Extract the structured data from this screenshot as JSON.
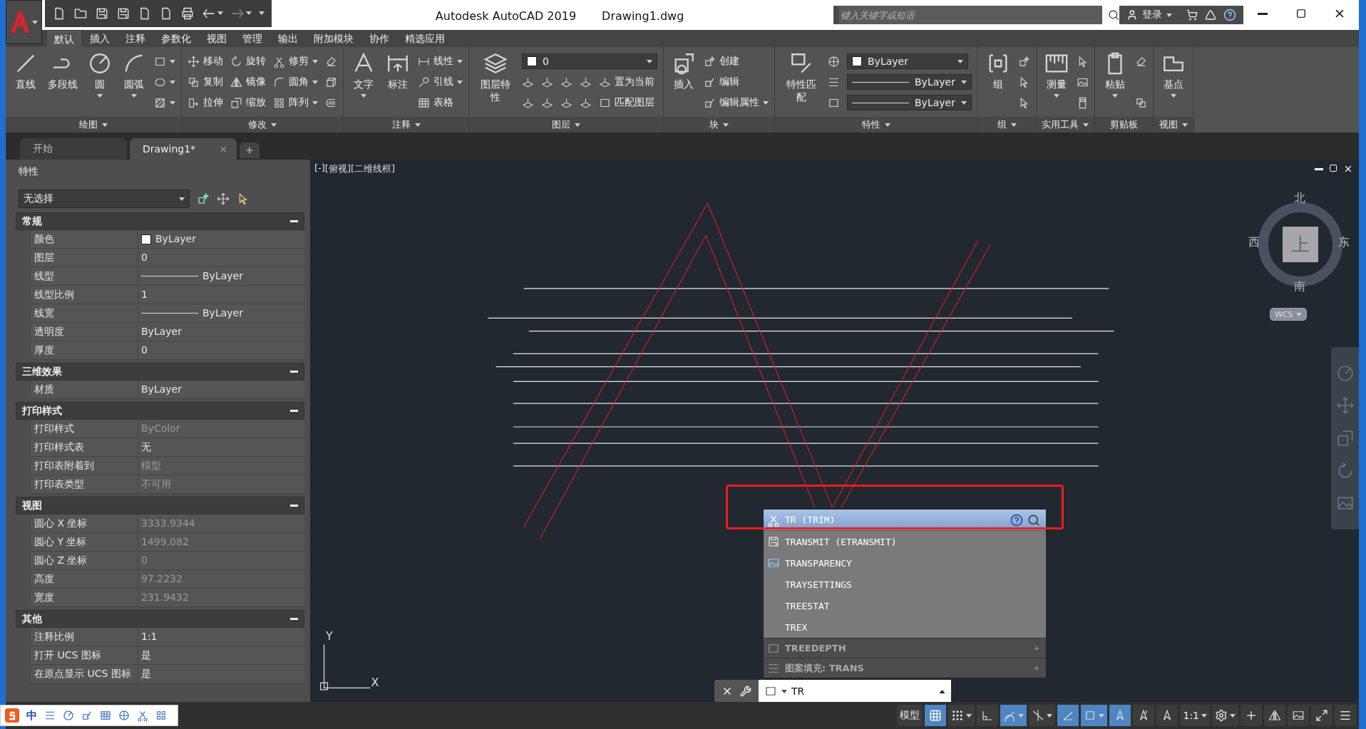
{
  "title_bar": {
    "app": "Autodesk AutoCAD 2019",
    "file": "Drawing1.dwg",
    "search": {
      "placeholder": "键入关键字或短语"
    },
    "login": "登录"
  },
  "ribbon": {
    "tabs": [
      {
        "label": "默认",
        "selected": true
      },
      {
        "label": "插入",
        "selected": false
      },
      {
        "label": "注释",
        "selected": false
      },
      {
        "label": "参数化",
        "selected": false
      },
      {
        "label": "视图",
        "selected": false
      },
      {
        "label": "管理",
        "selected": false
      },
      {
        "label": "输出",
        "selected": false
      },
      {
        "label": "附加模块",
        "selected": false
      },
      {
        "label": "协作",
        "selected": false
      },
      {
        "label": "精选应用",
        "selected": false
      }
    ],
    "panels": [
      {
        "title": "绘图",
        "menu": true,
        "large": [
          {
            "label": "直线",
            "dropdown": false
          },
          {
            "label": "多段线",
            "dropdown": false
          },
          {
            "label": "圆",
            "dropdown": true
          },
          {
            "label": "圆弧",
            "dropdown": true
          }
        ],
        "rows": [
          [
            {
              "kind": "icon",
              "dropdown": true
            }
          ],
          [
            {
              "kind": "icon",
              "dropdown": true
            }
          ],
          [
            {
              "kind": "icon",
              "dropdown": true
            }
          ]
        ]
      },
      {
        "title": "修改",
        "menu": true,
        "rows": [
          [
            {
              "kind": "small",
              "label": "移动",
              "dropdown": false
            },
            {
              "kind": "small",
              "label": "旋转",
              "dropdown": false
            },
            {
              "kind": "small",
              "label": "修剪",
              "dropdown": true
            },
            {
              "kind": "icon",
              "dropdown": false
            }
          ],
          [
            {
              "kind": "small",
              "label": "复制",
              "dropdown": false
            },
            {
              "kind": "small",
              "label": "镜像",
              "dropdown": false
            },
            {
              "kind": "small",
              "label": "圆角",
              "dropdown": true
            },
            {
              "kind": "icon",
              "dropdown": false
            }
          ],
          [
            {
              "kind": "small",
              "label": "拉伸",
              "dropdown": false
            },
            {
              "kind": "small",
              "label": "缩放",
              "dropdown": false
            },
            {
              "kind": "small",
              "label": "阵列",
              "dropdown": true
            },
            {
              "kind": "icon",
              "dropdown": false
            }
          ]
        ]
      },
      {
        "title": "注释",
        "menu": true,
        "large": [
          {
            "label": "文字",
            "dropdown": true
          },
          {
            "label": "标注",
            "dropdown": false
          }
        ],
        "rows": [
          [
            {
              "kind": "small",
              "label": "线性",
              "dropdown": true
            }
          ],
          [
            {
              "kind": "small",
              "label": "引线",
              "dropdown": true
            }
          ],
          [
            {
              "kind": "small",
              "label": "表格",
              "dropdown": false
            }
          ]
        ]
      },
      {
        "title": "图层",
        "menu": true,
        "large": [
          {
            "label": "图层特性",
            "dropdown": false
          }
        ],
        "rows": [
          [
            {
              "kind": "swatch_combo",
              "value": "0",
              "dropdown": true
            }
          ],
          [
            {
              "kind": "icon",
              "dropdown": false
            },
            {
              "kind": "icon",
              "dropdown": false
            },
            {
              "kind": "icon",
              "dropdown": false
            },
            {
              "kind": "icon",
              "dropdown": false
            },
            {
              "kind": "small",
              "label": "置为当前",
              "dropdown": false
            }
          ],
          [
            {
              "kind": "icon",
              "dropdown": false
            },
            {
              "kind": "icon",
              "dropdown": false
            },
            {
              "kind": "icon",
              "dropdown": false
            },
            {
              "kind": "icon",
              "dropdown": false
            },
            {
              "kind": "small",
              "label": "匹配图层",
              "dropdown": false
            }
          ]
        ]
      },
      {
        "title": "块",
        "menu": true,
        "large": [
          {
            "label": "插入",
            "dropdown": false
          }
        ],
        "rows": [
          [
            {
              "kind": "small",
              "label": "创建",
              "dropdown": false
            }
          ],
          [
            {
              "kind": "small",
              "label": "编辑",
              "dropdown": false
            }
          ],
          [
            {
              "kind": "small",
              "label": "编辑属性",
              "dropdown": true
            }
          ]
        ]
      },
      {
        "title": "特性",
        "menu": true,
        "large": [
          {
            "label": "特性匹配",
            "dropdown": false
          }
        ],
        "rows": [
          [
            {
              "kind": "icon",
              "dropdown": false
            },
            {
              "kind": "swatch_combo",
              "value": "ByLayer",
              "dropdown": true
            }
          ],
          [
            {
              "kind": "icon",
              "dropdown": false
            },
            {
              "kind": "line_combo",
              "value": "ByLayer",
              "dropdown": true
            }
          ],
          [
            {
              "kind": "icon",
              "dropdown": false
            },
            {
              "kind": "line_combo",
              "value": "ByLayer",
              "dropdown": true
            }
          ]
        ]
      },
      {
        "title": "组",
        "menu": true,
        "large": [
          {
            "label": "组",
            "dropdown": false
          }
        ],
        "rows": [
          [
            {
              "kind": "icon",
              "dropdown": false
            }
          ],
          [
            {
              "kind": "icon",
              "dropdown": false
            }
          ],
          [
            {
              "kind": "icon",
              "dropdown": false
            }
          ]
        ]
      },
      {
        "title": "实用工具",
        "menu": true,
        "large": [
          {
            "label": "测量",
            "dropdown": true
          }
        ],
        "rows": [
          [
            {
              "kind": "icon",
              "dropdown": false
            }
          ],
          [
            {
              "kind": "icon",
              "dropdown": false
            }
          ],
          [
            {
              "kind": "icon",
              "dropdown": false
            }
          ]
        ]
      },
      {
        "title": "剪贴板",
        "menu": false,
        "large": [
          {
            "label": "粘贴",
            "dropdown": true
          }
        ],
        "rows": [
          [
            {
              "kind": "icon",
              "dropdown": false
            }
          ],
          [
            {
              "kind": "icon",
              "dropdown": false
            }
          ]
        ]
      },
      {
        "title": "视图",
        "menu": true,
        "large": [
          {
            "label": "基点",
            "dropdown": true
          }
        ]
      }
    ]
  },
  "doc_tabs": [
    {
      "label": "开始",
      "selected": false
    },
    {
      "label": "Drawing1*",
      "selected": true
    }
  ],
  "properties": {
    "title": "特性",
    "selection": "无选择",
    "sections": [
      {
        "title": "常规",
        "expanded": true,
        "rows": [
          {
            "label": "颜色",
            "value": "ByLayer",
            "kind": "swatch",
            "disabled": false
          },
          {
            "label": "图层",
            "value": "0",
            "kind": "text",
            "disabled": false
          },
          {
            "label": "线型",
            "value": "ByLayer",
            "kind": "line",
            "disabled": false
          },
          {
            "label": "线型比例",
            "value": "1",
            "kind": "text",
            "disabled": false
          },
          {
            "label": "线宽",
            "value": "ByLayer",
            "kind": "line",
            "disabled": false
          },
          {
            "label": "透明度",
            "value": "ByLayer",
            "kind": "text",
            "disabled": false
          },
          {
            "label": "厚度",
            "value": "0",
            "kind": "text",
            "disabled": false
          }
        ]
      },
      {
        "title": "三维效果",
        "expanded": true,
        "rows": [
          {
            "label": "材质",
            "value": "ByLayer",
            "kind": "text",
            "disabled": false
          }
        ]
      },
      {
        "title": "打印样式",
        "expanded": true,
        "rows": [
          {
            "label": "打印样式",
            "value": "ByColor",
            "kind": "text",
            "disabled": true
          },
          {
            "label": "打印样式表",
            "value": "无",
            "kind": "text",
            "disabled": false
          },
          {
            "label": "打印表附着到",
            "value": "模型",
            "kind": "text",
            "disabled": true
          },
          {
            "label": "打印表类型",
            "value": "不可用",
            "kind": "text",
            "disabled": true
          }
        ]
      },
      {
        "title": "视图",
        "expanded": true,
        "rows": [
          {
            "label": "圆心 X 坐标",
            "value": "3333.9344",
            "kind": "text",
            "disabled": true
          },
          {
            "label": "圆心 Y 坐标",
            "value": "1499.082",
            "kind": "text",
            "disabled": true
          },
          {
            "label": "圆心 Z 坐标",
            "value": "0",
            "kind": "text",
            "disabled": true
          },
          {
            "label": "高度",
            "value": "97.2232",
            "kind": "text",
            "disabled": true
          },
          {
            "label": "宽度",
            "value": "231.9432",
            "kind": "text",
            "disabled": true
          }
        ]
      },
      {
        "title": "其他",
        "expanded": true,
        "rows": [
          {
            "label": "注释比例",
            "value": "1:1",
            "kind": "text",
            "disabled": false
          },
          {
            "label": "打开 UCS 图标",
            "value": "是",
            "kind": "text",
            "disabled": false
          },
          {
            "label": "在原点显示 UCS 图标",
            "value": "是",
            "kind": "text",
            "disabled": false
          }
        ]
      }
    ]
  },
  "viewport": {
    "controls": [
      "[-]",
      "[俯视]",
      "[二维线框]"
    ],
    "viewcube": {
      "north": "北",
      "south": "南",
      "east": "东",
      "west": "西",
      "face": "上",
      "ucs": "WCS"
    },
    "ucs_axes": {
      "x": "X",
      "y": "Y"
    }
  },
  "autocomplete": {
    "items": [
      {
        "label": "TR (TRIM)",
        "selected": true
      },
      {
        "label": "TRANSMIT (ETRANSMIT)",
        "selected": false
      },
      {
        "label": "TRANSPARENCY",
        "selected": false
      },
      {
        "label": "TRAYSETTINGS",
        "selected": false
      },
      {
        "label": "TREESTAT",
        "selected": false
      },
      {
        "label": "TREX",
        "selected": false
      }
    ],
    "groups": [
      {
        "label": "TREEDEPTH"
      },
      {
        "label": "图案填充: TRANS"
      }
    ]
  },
  "command_line": {
    "value": "TR"
  },
  "ime_bar": {
    "mode": "中"
  },
  "status_bar": {
    "model": "模型",
    "toggles": [
      {
        "on": true,
        "dropdown": false
      },
      {
        "on": false,
        "dropdown": true
      },
      {
        "on": false,
        "dropdown": false
      },
      {
        "on": true,
        "dropdown": true
      },
      {
        "on": false,
        "dropdown": true
      },
      {
        "on": true,
        "dropdown": false
      },
      {
        "on": true,
        "dropdown": true
      },
      {
        "on": true,
        "dropdown": false
      },
      {
        "on": false,
        "dropdown": false
      },
      {
        "on": false,
        "dropdown": false
      }
    ],
    "scale": "1:1"
  }
}
